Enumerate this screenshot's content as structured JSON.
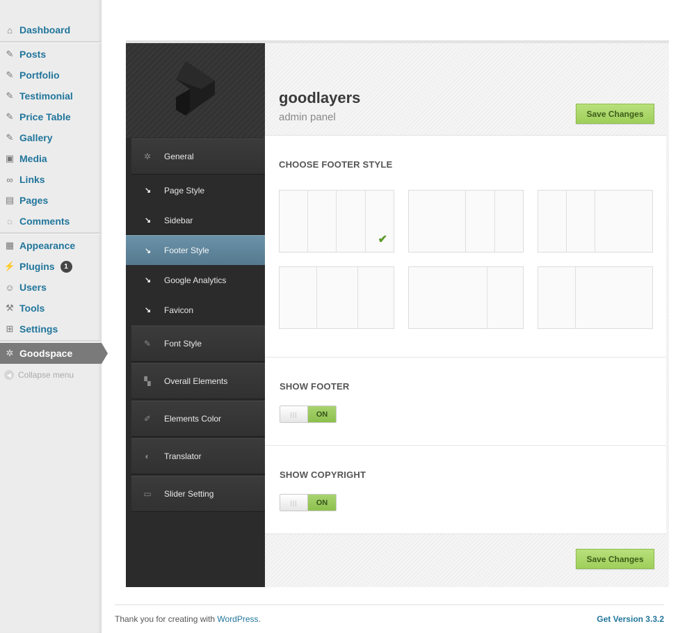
{
  "wp_menu": {
    "items": [
      {
        "label": "Dashboard",
        "icon": "dashboard-icon"
      },
      {
        "label": "Posts",
        "icon": "pin-icon"
      },
      {
        "label": "Portfolio",
        "icon": "pin-icon"
      },
      {
        "label": "Testimonial",
        "icon": "pin-icon"
      },
      {
        "label": "Price Table",
        "icon": "pin-icon"
      },
      {
        "label": "Gallery",
        "icon": "pin-icon"
      },
      {
        "label": "Media",
        "icon": "media-icon"
      },
      {
        "label": "Links",
        "icon": "link-icon"
      },
      {
        "label": "Pages",
        "icon": "pages-icon"
      },
      {
        "label": "Comments",
        "icon": "comment-icon"
      },
      {
        "label": "Appearance",
        "icon": "appearance-icon"
      },
      {
        "label": "Plugins",
        "icon": "plugin-icon",
        "badge": "1"
      },
      {
        "label": "Users",
        "icon": "users-icon"
      },
      {
        "label": "Tools",
        "icon": "tools-icon"
      },
      {
        "label": "Settings",
        "icon": "settings-icon"
      },
      {
        "label": "Goodspace",
        "icon": "gear-icon",
        "current": true
      }
    ],
    "collapse_label": "Collapse menu"
  },
  "panel": {
    "brand": "goodlayers",
    "subtitle": "admin panel",
    "save_label": "Save Changes",
    "nav": [
      {
        "label": "General",
        "icon": "gear-icon",
        "type": "main"
      },
      {
        "label": "Page Style",
        "type": "sub"
      },
      {
        "label": "Sidebar",
        "type": "sub"
      },
      {
        "label": "Footer Style",
        "type": "sub",
        "active": true
      },
      {
        "label": "Google Analytics",
        "type": "sub"
      },
      {
        "label": "Favicon",
        "type": "sub"
      },
      {
        "label": "Font Style",
        "icon": "pencil-icon",
        "type": "main"
      },
      {
        "label": "Overall Elements",
        "icon": "layout-icon",
        "type": "main"
      },
      {
        "label": "Elements Color",
        "icon": "brush-icon",
        "type": "main"
      },
      {
        "label": "Translator",
        "icon": "translator-icon",
        "type": "main"
      },
      {
        "label": "Slider Setting",
        "icon": "slider-icon",
        "type": "main"
      }
    ],
    "sections": {
      "footer_style_title": "CHOOSE FOOTER STYLE",
      "show_footer_title": "SHOW FOOTER",
      "show_footer_state": "ON",
      "show_copyright_title": "SHOW COPYRIGHT",
      "show_copyright_state": "ON"
    },
    "footer_styles_selected": 1
  },
  "footer": {
    "thanks_prefix": "Thank you for creating with ",
    "wordpress_link": "WordPress",
    "thanks_suffix": ".",
    "version": "Get Version 3.3.2"
  },
  "colors": {
    "link": "#21759b",
    "accent_green": "#9fcf5b",
    "active_nav": "#5f879e"
  }
}
